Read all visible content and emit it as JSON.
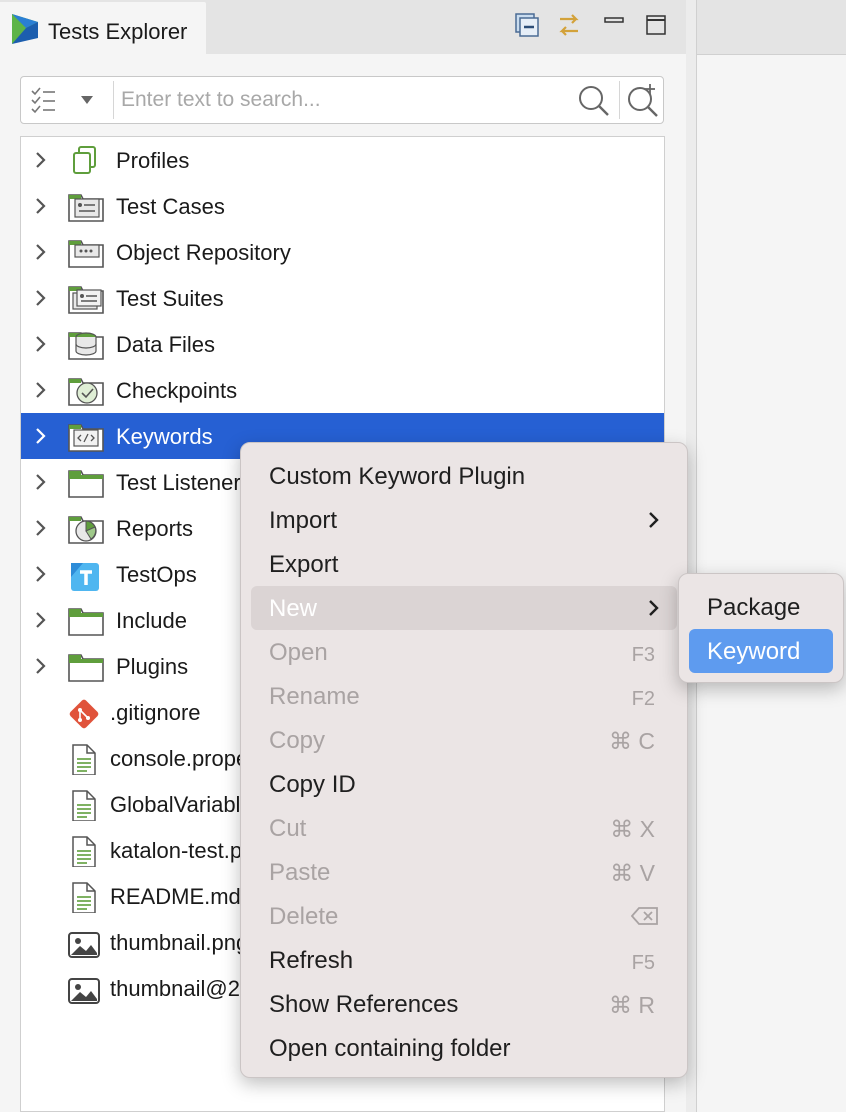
{
  "panel": {
    "title": "Tests Explorer",
    "toolbar_icons": [
      "minimize-view-icon",
      "link-editor-icon",
      "minimize-icon",
      "maximize-icon"
    ]
  },
  "search": {
    "placeholder": "Enter text to search...",
    "icons": [
      "checklist-icon",
      "dropdown-icon",
      "search-icon",
      "advanced-search-icon"
    ]
  },
  "tree": {
    "items": [
      {
        "label": "Profiles",
        "icon": "profiles-icon",
        "expandable": true
      },
      {
        "label": "Test Cases",
        "icon": "test-cases-folder-icon",
        "expandable": true
      },
      {
        "label": "Object Repository",
        "icon": "object-repository-folder-icon",
        "expandable": true
      },
      {
        "label": "Test Suites",
        "icon": "test-suites-folder-icon",
        "expandable": true
      },
      {
        "label": "Data Files",
        "icon": "data-files-folder-icon",
        "expandable": true
      },
      {
        "label": "Checkpoints",
        "icon": "checkpoints-folder-icon",
        "expandable": true
      },
      {
        "label": "Keywords",
        "icon": "keywords-folder-icon",
        "expandable": true,
        "selected": true
      },
      {
        "label": "Test Listeners",
        "icon": "folder-icon",
        "expandable": true
      },
      {
        "label": "Reports",
        "icon": "reports-folder-icon",
        "expandable": true
      },
      {
        "label": "TestOps",
        "icon": "testops-icon",
        "expandable": true
      },
      {
        "label": "Include",
        "icon": "folder-icon",
        "expandable": true
      },
      {
        "label": "Plugins",
        "icon": "folder-icon",
        "expandable": true
      },
      {
        "label": ".gitignore",
        "icon": "git-icon",
        "expandable": false
      },
      {
        "label": "console.properties",
        "icon": "text-file-icon",
        "expandable": false
      },
      {
        "label": "GlobalVariables.glbl",
        "icon": "text-file-icon",
        "expandable": false
      },
      {
        "label": "katalon-test.prj",
        "icon": "text-file-icon",
        "expandable": false
      },
      {
        "label": "README.md",
        "icon": "text-file-icon",
        "expandable": false
      },
      {
        "label": "thumbnail.png",
        "icon": "image-file-icon",
        "expandable": false
      },
      {
        "label": "thumbnail@2x.png",
        "icon": "image-file-icon",
        "expandable": false
      }
    ]
  },
  "context_menu": {
    "items": [
      {
        "label": "Custom Keyword Plugin",
        "shortcut": "",
        "enabled": true
      },
      {
        "label": "Import",
        "shortcut": "",
        "enabled": true,
        "submenu": true
      },
      {
        "label": "Export",
        "shortcut": "",
        "enabled": true
      },
      {
        "label": "New",
        "shortcut": "",
        "enabled": true,
        "submenu": true,
        "highlighted": true
      },
      {
        "label": "Open",
        "shortcut": "F3",
        "enabled": false
      },
      {
        "label": "Rename",
        "shortcut": "F2",
        "enabled": false
      },
      {
        "label": "Copy",
        "shortcut": "⌘ C",
        "enabled": false
      },
      {
        "label": "Copy ID",
        "shortcut": "",
        "enabled": true
      },
      {
        "label": "Cut",
        "shortcut": "⌘ X",
        "enabled": false
      },
      {
        "label": "Paste",
        "shortcut": "⌘ V",
        "enabled": false
      },
      {
        "label": "Delete",
        "shortcut": "",
        "shortcut_icon": "delete-key-icon",
        "enabled": false
      },
      {
        "label": "Refresh",
        "shortcut": "F5",
        "enabled": true
      },
      {
        "label": "Show References",
        "shortcut": "⌘ R",
        "enabled": true
      },
      {
        "label": "Open containing folder",
        "shortcut": "",
        "enabled": true
      }
    ]
  },
  "submenu_new": {
    "items": [
      {
        "label": "Package",
        "active": false
      },
      {
        "label": "Keyword",
        "active": true
      }
    ]
  },
  "colors": {
    "selection": "#2660d3",
    "submenu_active": "#5e9bef",
    "menu_bg": "#ebe5e5",
    "icon_green": "#5f9e3c"
  }
}
